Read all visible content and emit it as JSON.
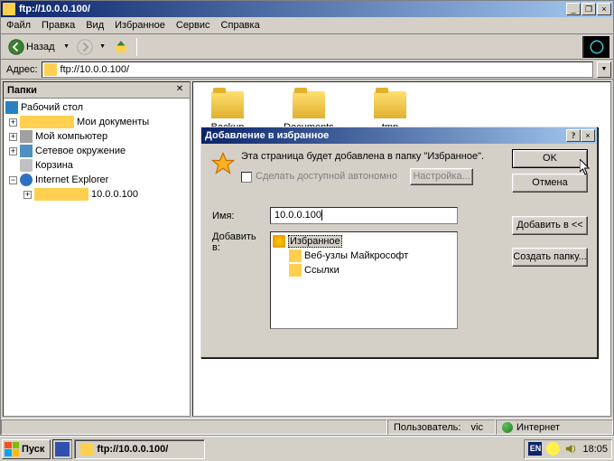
{
  "window": {
    "title": "ftp://10.0.0.100/",
    "min": "_",
    "max": "□",
    "restore": "❐",
    "close": "✕"
  },
  "menu": {
    "file": "Файл",
    "edit": "Правка",
    "view": "Вид",
    "favorites": "Избранное",
    "tools": "Сервис",
    "help": "Справка"
  },
  "toolbar": {
    "back_label": "Назад"
  },
  "address": {
    "label": "Адрес:",
    "value": "ftp://10.0.0.100/"
  },
  "side": {
    "title": "Папки",
    "close": "✕"
  },
  "tree": {
    "desktop": "Рабочий стол",
    "mydocs": "Мои документы",
    "mycomp": "Мой компьютер",
    "nethood": "Сетевое окружение",
    "trash": "Корзина",
    "ie": "Internet Explorer",
    "ftp": "10.0.0.100"
  },
  "folders": [
    {
      "name": "Backup"
    },
    {
      "name": "Documents"
    },
    {
      "name": "tmp"
    }
  ],
  "dialog": {
    "title": "Добавление в избранное",
    "help": "?",
    "close": "✕",
    "info": "Эта страница будет добавлена в папку \"Избранное\".",
    "offline": "Сделать доступной автономно",
    "customize": "Настройка...",
    "ok": "OK",
    "cancel": "Отмена",
    "name_label": "Имя:",
    "name_value": "10.0.0.100",
    "addto_toggle": "Добавить в <<",
    "addto_label": "Добавить в:",
    "newfolder": "Создать папку...",
    "fav_root": "Избранное",
    "fav_ms": "Веб-узлы Майкрософт",
    "fav_links": "Ссылки"
  },
  "status": {
    "user_label": "Пользователь:",
    "user": "vic",
    "zone": "Интернет"
  },
  "taskbar": {
    "start": "Пуск",
    "task": "ftp://10.0.0.100/",
    "lang": "EN",
    "clock": "18:05"
  }
}
